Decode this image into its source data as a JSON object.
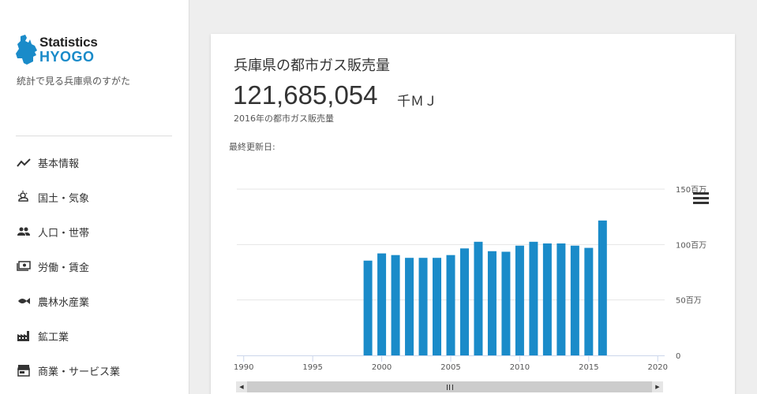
{
  "brand": {
    "title_top": "Statistics",
    "title_bottom": "HYOGO",
    "tagline": "統計で見る兵庫県のすがた",
    "accent": "#1a8bc9"
  },
  "sidebar": {
    "items": [
      {
        "label": "基本情報",
        "icon": "trending-up-icon"
      },
      {
        "label": "国土・気象",
        "icon": "weather-icon"
      },
      {
        "label": "人口・世帯",
        "icon": "people-icon"
      },
      {
        "label": "労働・賃金",
        "icon": "money-icon"
      },
      {
        "label": "農林水産業",
        "icon": "fish-icon"
      },
      {
        "label": "鉱工業",
        "icon": "factory-icon"
      },
      {
        "label": "商業・サービス業",
        "icon": "store-icon"
      }
    ]
  },
  "card": {
    "title": "兵庫県の都市ガス販売量",
    "value": "121,685,054",
    "unit": "千ＭＪ",
    "caption": "2016年の都市ガス販売量",
    "updated_label": "最終更新日:"
  },
  "chart_data": {
    "type": "bar",
    "x": [
      1999,
      2000,
      2001,
      2002,
      2003,
      2004,
      2005,
      2006,
      2007,
      2008,
      2009,
      2010,
      2011,
      2012,
      2013,
      2014,
      2015,
      2016
    ],
    "values": [
      85500000,
      92000000,
      90500000,
      88000000,
      88000000,
      88000000,
      90500000,
      96500000,
      102500000,
      94000000,
      93500000,
      99000000,
      102500000,
      101000000,
      101000000,
      99000000,
      97000000,
      121685054
    ],
    "xlim": [
      1989.5,
      2020.5
    ],
    "xticks": [
      "1990",
      "1995",
      "2000",
      "2005",
      "2010",
      "2015",
      "2020"
    ],
    "ylim": [
      0,
      150000000
    ],
    "yticks": [
      "0",
      "50百万",
      "100百万",
      "150百万"
    ],
    "yaxis_side": "right",
    "bar_color": "#1a8bc9",
    "grid": true
  }
}
